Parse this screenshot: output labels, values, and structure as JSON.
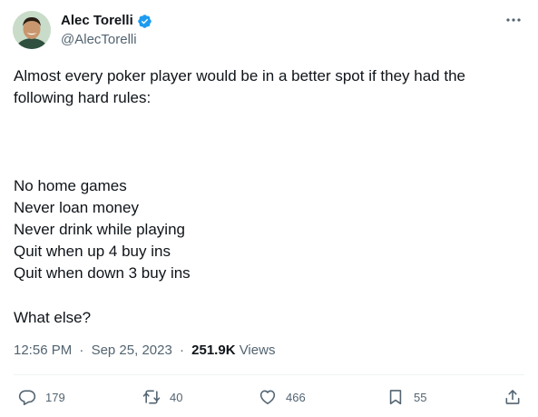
{
  "author": {
    "name": "Alec Torelli",
    "handle": "@AlecTorelli",
    "verified": true
  },
  "tweet": {
    "intro": "Almost every poker player would be in a better spot if they had the following hard rules:",
    "rules": [
      "No home games",
      "Never loan money",
      "Never drink while playing",
      "Quit when up 4 buy ins",
      "Quit when down 3 buy ins"
    ],
    "outro": "What else?"
  },
  "meta": {
    "time": "12:56 PM",
    "separator": "·",
    "date": "Sep 25, 2023",
    "views_count": "251.9K",
    "views_label": "Views"
  },
  "actions": {
    "replies": "179",
    "retweets": "40",
    "likes": "466",
    "bookmarks": "55"
  },
  "colors": {
    "verified_blue": "#1d9bf0",
    "secondary_text": "#536471",
    "primary_text": "#0f1419"
  },
  "icons": [
    "verified-badge-icon",
    "more-icon",
    "reply-icon",
    "retweet-icon",
    "like-icon",
    "bookmark-icon",
    "share-icon"
  ]
}
